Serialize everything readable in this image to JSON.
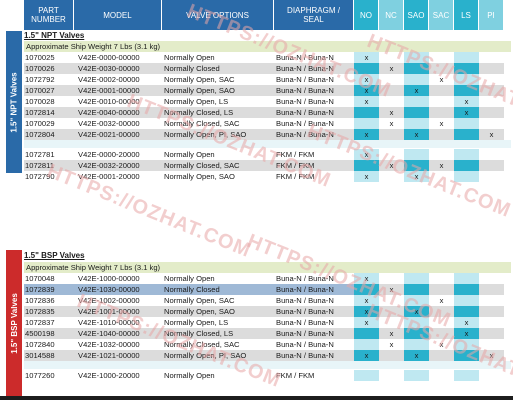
{
  "header": {
    "part": "PART\nNUMBER",
    "model": "MODEL",
    "valve": "VALVE OPTIONS",
    "diaph": "DIAPHRAGM /\nSEAL",
    "cols": [
      "NO",
      "NC",
      "SAO",
      "SAC",
      "LS",
      "PI"
    ]
  },
  "npt": {
    "side": "1.5\" NPT Valves",
    "title": "1.5\" NPT Valves",
    "weight": "Approximate Ship Weight 7 Lbs (3.1 kg)",
    "rows": [
      {
        "part": "1070025",
        "model": "V42E-0000-00000",
        "valve": "Normally Open",
        "diaph": "Buna-N / Buna-N",
        "x": [
          "x",
          "",
          "",
          "",
          "",
          ""
        ]
      },
      {
        "part": "1070026",
        "model": "V42E-0030-00000",
        "valve": "Normally Closed",
        "diaph": "Buna-N / Buna-N",
        "x": [
          "",
          "x",
          "",
          "",
          "",
          ""
        ]
      },
      {
        "part": "1072792",
        "model": "V42E-0002-00000",
        "valve": "Normally Open, SAC",
        "diaph": "Buna-N / Buna-N",
        "x": [
          "x",
          "",
          "",
          "x",
          "",
          ""
        ]
      },
      {
        "part": "1070027",
        "model": "V42E-0001-00000",
        "valve": "Normally Open, SAO",
        "diaph": "Buna-N / Buna-N",
        "x": [
          "x",
          "",
          "x",
          "",
          "",
          ""
        ]
      },
      {
        "part": "1070028",
        "model": "V42E-0010-00000",
        "valve": "Normally Open, LS",
        "diaph": "Buna-N / Buna-N",
        "x": [
          "x",
          "",
          "",
          "",
          "x",
          ""
        ]
      },
      {
        "part": "1072814",
        "model": "V42E-0040-00000",
        "valve": "Normally Closed, LS",
        "diaph": "Buna-N / Buna-N",
        "x": [
          "",
          "x",
          "",
          "",
          "x",
          ""
        ]
      },
      {
        "part": "1070029",
        "model": "V42E-0032-00000",
        "valve": "Normally Closed, SAC",
        "diaph": "Buna-N / Buna-N",
        "x": [
          "",
          "x",
          "",
          "x",
          "",
          ""
        ]
      },
      {
        "part": "1072804",
        "model": "V42E-0021-00000",
        "valve": "Normally Open, PI, SAO",
        "diaph": "Buna-N / Buna-N",
        "x": [
          "x",
          "",
          "x",
          "",
          "",
          "x"
        ]
      },
      {
        "part": "1072781",
        "model": "V42E-0000-20000",
        "valve": "Normally Open",
        "diaph": "FKM / FKM",
        "x": [
          "x",
          "",
          "",
          "",
          "",
          ""
        ]
      },
      {
        "part": "1072811",
        "model": "V42E-0032-20000",
        "valve": "Normally Closed, SAC",
        "diaph": "FKM / FKM",
        "x": [
          "",
          "x",
          "",
          "x",
          "",
          ""
        ]
      },
      {
        "part": "1072790",
        "model": "V42E-0001-20000",
        "valve": "Normally Open, SAO",
        "diaph": "FKM / FKM",
        "x": [
          "x",
          "",
          "x",
          "",
          "",
          ""
        ]
      }
    ]
  },
  "bsp": {
    "side": "1.5\" BSP Valves",
    "title": "1.5\" BSP Valves",
    "weight": "Approximate Ship Weight 7 Lbs (3.1 kg)",
    "rows": [
      {
        "part": "1070048",
        "model": "V42E-1000-00000",
        "valve": "Normally Open",
        "diaph": "Buna-N / Buna-N",
        "x": [
          "x",
          "",
          "",
          "",
          "",
          ""
        ]
      },
      {
        "part": "1072839",
        "model": "V42E-1030-00000",
        "valve": "Normally Closed",
        "diaph": "Buna-N / Buna-N",
        "x": [
          "",
          "x",
          "",
          "",
          "",
          ""
        ]
      },
      {
        "part": "1072836",
        "model": "V42E-1002-00000",
        "valve": "Normally Open, SAC",
        "diaph": "Buna-N / Buna-N",
        "x": [
          "x",
          "",
          "",
          "x",
          "",
          ""
        ]
      },
      {
        "part": "1072835",
        "model": "V42E-1001-00000",
        "valve": "Normally Open, SAO",
        "diaph": "Buna-N / Buna-N",
        "x": [
          "x",
          "",
          "x",
          "",
          "",
          ""
        ]
      },
      {
        "part": "1072837",
        "model": "V42E-1010-00000",
        "valve": "Normally Open, LS",
        "diaph": "Buna-N / Buna-N",
        "x": [
          "x",
          "",
          "",
          "",
          "x",
          ""
        ]
      },
      {
        "part": "4500198",
        "model": "V42E-1040-00000",
        "valve": "Normally Closed, LS",
        "diaph": "Buna-N / Buna-N",
        "x": [
          "",
          "x",
          "",
          "",
          "x",
          ""
        ]
      },
      {
        "part": "1072840",
        "model": "V42E-1032-00000",
        "valve": "Normally Closed, SAC",
        "diaph": "Buna-N / Buna-N",
        "x": [
          "",
          "x",
          "",
          "x",
          "",
          ""
        ]
      },
      {
        "part": "3014588",
        "model": "V42E-1021-00000",
        "valve": "Normally Open, PI, SAO",
        "diaph": "Buna-N / Buna-N",
        "x": [
          "x",
          "",
          "x",
          "",
          "",
          "x"
        ]
      },
      {
        "part": "1077260",
        "model": "V42E-1000-20000",
        "valve": "Normally Open",
        "diaph": "FKM / FKM",
        "x": [
          "",
          "",
          "",
          "",
          "",
          ""
        ]
      }
    ]
  },
  "watermark": "HTTPS://OZHAT.COM",
  "colors": {
    "npt": "#2a6aa8",
    "bsp": "#cc2b2b",
    "accent": "#29b1cc"
  }
}
